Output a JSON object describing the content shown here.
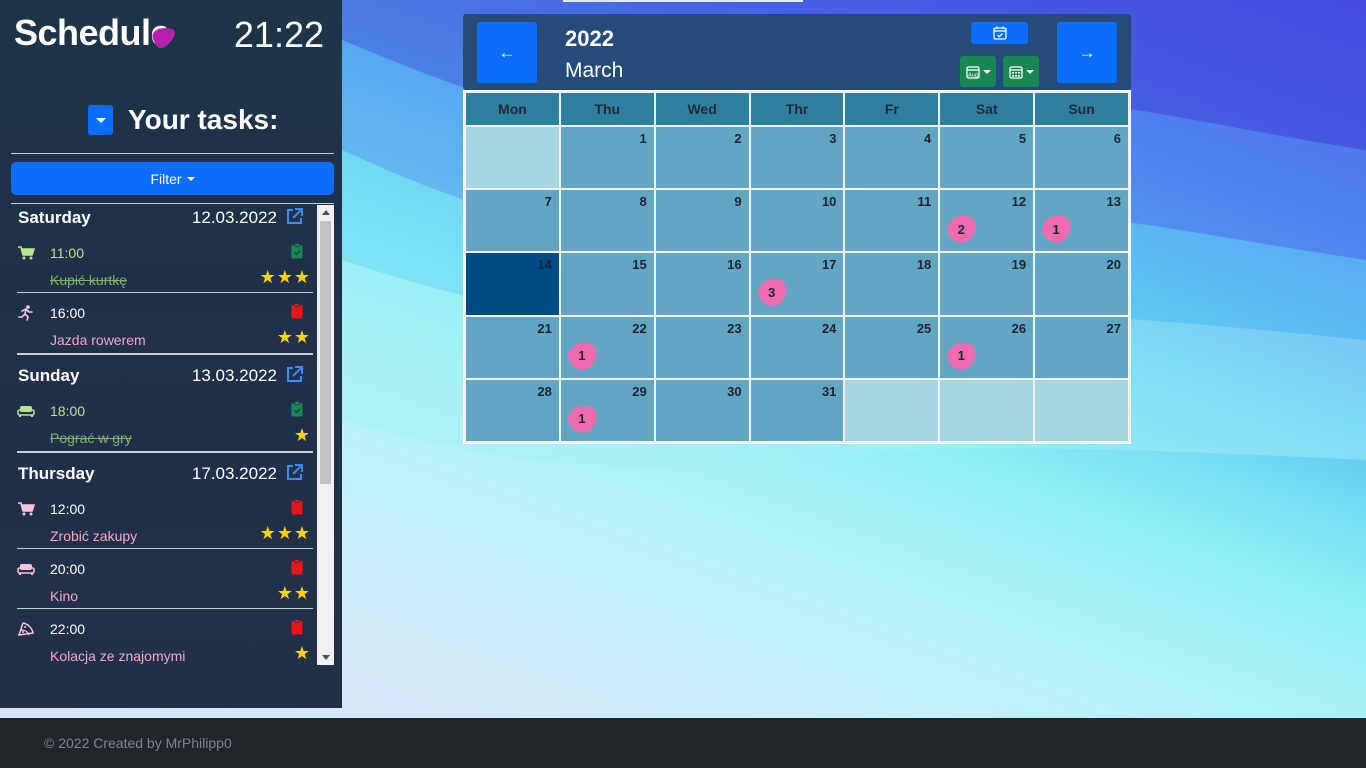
{
  "app": {
    "brand": "Schedule",
    "clock": "21:22",
    "tasks_title": "Your tasks:",
    "filter_label": "Filter"
  },
  "days": [
    {
      "name": "Saturday",
      "date": "12.03.2022",
      "tasks": [
        {
          "icon": "cart-icon",
          "time": "11:00",
          "name": "Kupić kurtkę",
          "done": true,
          "stars": "★★★"
        },
        {
          "icon": "running-icon",
          "time": "16:00",
          "name": "Jazda rowerem",
          "done": false,
          "stars": "★★"
        }
      ]
    },
    {
      "name": "Sunday",
      "date": "13.03.2022",
      "tasks": [
        {
          "icon": "couch-icon",
          "time": "18:00",
          "name": "Pograć w gry",
          "done": true,
          "stars": "★"
        }
      ]
    },
    {
      "name": "Thursday",
      "date": "17.03.2022",
      "tasks": [
        {
          "icon": "cart-icon",
          "time": "12:00",
          "name": "Zrobić zakupy",
          "done": false,
          "stars": "★★★"
        },
        {
          "icon": "couch-icon",
          "time": "20:00",
          "name": "Kino",
          "done": false,
          "stars": "★★"
        },
        {
          "icon": "pizza-icon",
          "time": "22:00",
          "name": "Kolacja ze znajomymi",
          "done": false,
          "stars": "★"
        }
      ]
    }
  ],
  "calendar": {
    "year": "2022",
    "month": "March",
    "prev_label": "←",
    "next_label": "→",
    "weekdays": [
      "Mon",
      "Thu",
      "Wed",
      "Thr",
      "Fr",
      "Sat",
      "Sun"
    ],
    "cells": [
      {
        "day": "",
        "empty": true
      },
      {
        "day": "1"
      },
      {
        "day": "2"
      },
      {
        "day": "3"
      },
      {
        "day": "4"
      },
      {
        "day": "5"
      },
      {
        "day": "6"
      },
      {
        "day": "7"
      },
      {
        "day": "8"
      },
      {
        "day": "9"
      },
      {
        "day": "10"
      },
      {
        "day": "11"
      },
      {
        "day": "12",
        "count": "2"
      },
      {
        "day": "13",
        "count": "1"
      },
      {
        "day": "14",
        "today": true
      },
      {
        "day": "15"
      },
      {
        "day": "16"
      },
      {
        "day": "17",
        "count": "3"
      },
      {
        "day": "18"
      },
      {
        "day": "19"
      },
      {
        "day": "20"
      },
      {
        "day": "21"
      },
      {
        "day": "22",
        "count": "1"
      },
      {
        "day": "23"
      },
      {
        "day": "24"
      },
      {
        "day": "25"
      },
      {
        "day": "26",
        "count": "1"
      },
      {
        "day": "27"
      },
      {
        "day": "28"
      },
      {
        "day": "29",
        "count": "1"
      },
      {
        "day": "30"
      },
      {
        "day": "31"
      },
      {
        "day": "",
        "empty": true
      },
      {
        "day": "",
        "empty": true
      },
      {
        "day": "",
        "empty": true
      }
    ]
  },
  "footer": {
    "text": "© 2022 Created by MrPhilipp0"
  },
  "colors": {
    "accent": "#0d6efd",
    "success": "#198754",
    "badge": "#f06ab0",
    "star": "#ffd500"
  }
}
